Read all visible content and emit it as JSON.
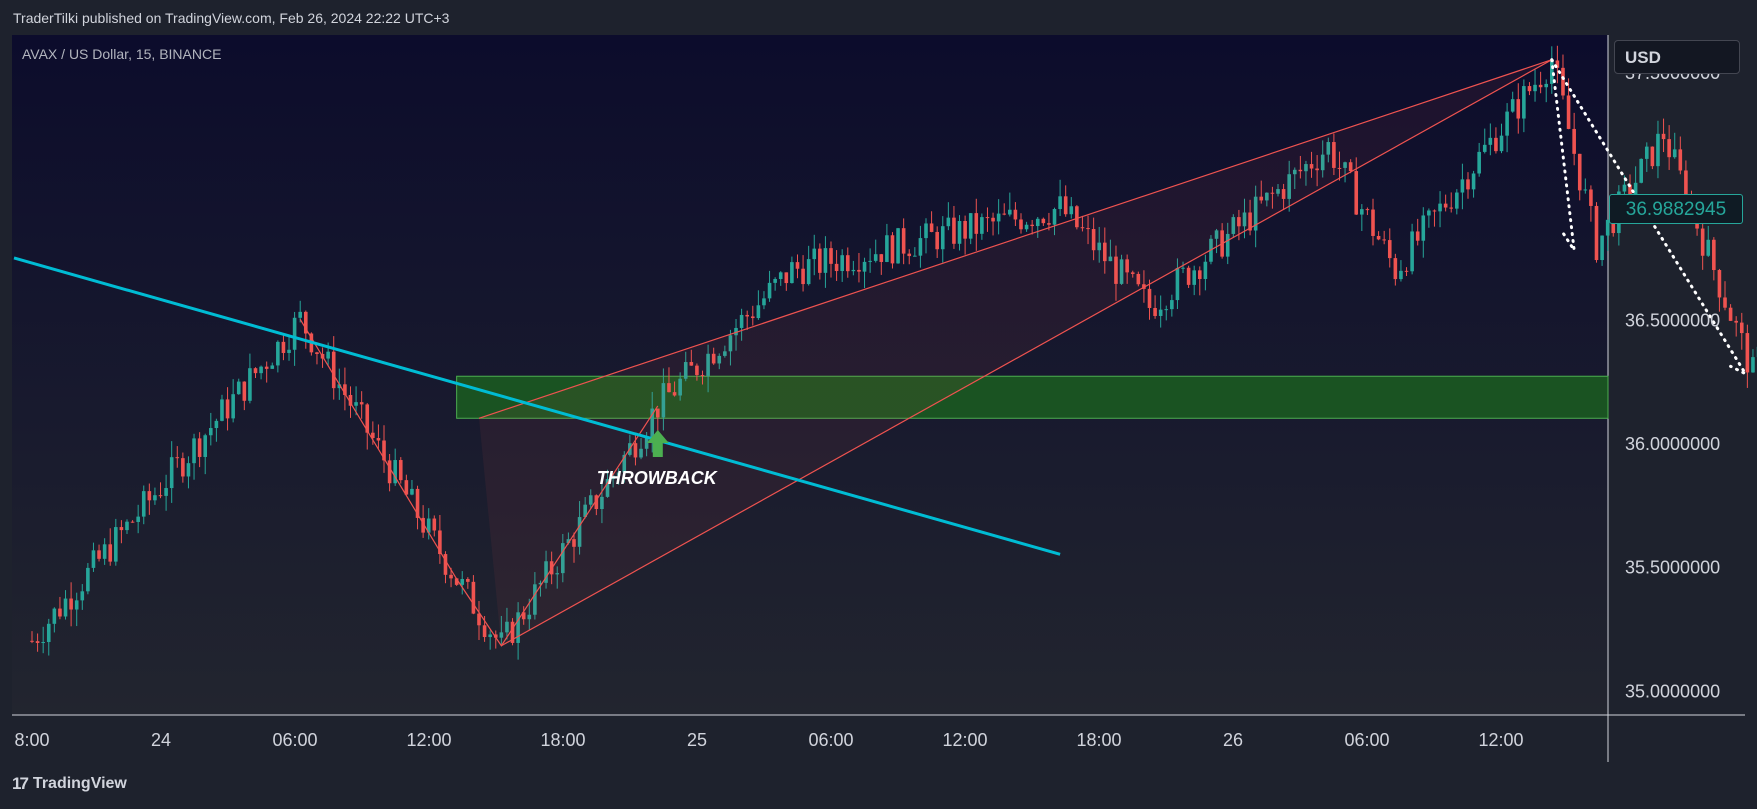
{
  "header": {
    "text": "TraderTilki published on TradingView.com, Feb 26, 2024 22:22 UTC+3"
  },
  "symbol": {
    "text": "AVAX / US Dollar, 15, BINANCE"
  },
  "currency": {
    "label": "USD"
  },
  "last_price": {
    "label": "36.9882945",
    "value": 36.9882945,
    "color": "#26a69a"
  },
  "annotation": {
    "throwback": "THROWBACK",
    "arrow_color": "#4caf50"
  },
  "footer": {
    "logo_mark": "17",
    "brand": "TradingView"
  },
  "colors": {
    "background": "#131722",
    "up": "#26a69a",
    "down": "#ef5350",
    "trendline": "#00bcd4",
    "zone": "#1b5e20",
    "zone_border": "#4caf50",
    "pattern": "#ef5350"
  },
  "chart_data": {
    "type": "candlestick",
    "title": "AVAX / US Dollar, 15, BINANCE",
    "ylim": [
      34.9,
      37.65
    ],
    "y_ticks": [
      "37.5000000",
      "36.5000000",
      "36.0000000",
      "35.5000000",
      "35.0000000"
    ],
    "y_tick_values": [
      37.5,
      36.5,
      36.0,
      35.5,
      35.0
    ],
    "x_ticks": [
      "8:00",
      "24",
      "06:00",
      "12:00",
      "18:00",
      "25",
      "06:00",
      "12:00",
      "18:00",
      "26",
      "06:00",
      "12:00"
    ],
    "support_zone": {
      "low": 36.1,
      "high": 36.27,
      "start": "Feb 24 03:00"
    },
    "descending_trendline": [
      [
        "Feb 23 08:00",
        36.72
      ],
      [
        "Feb 25 06:00",
        35.55
      ]
    ],
    "rising_wedge_upper": [
      [
        "Feb 24 04:00",
        36.1
      ],
      [
        "Feb 26 04:00",
        37.55
      ]
    ],
    "rising_wedge_lower": [
      [
        "Feb 24 05:00",
        35.18
      ],
      [
        "Feb 26 04:00",
        37.55
      ]
    ],
    "key_points": [
      {
        "time": "Feb 23 08:00",
        "price": 35.2
      },
      {
        "time": "Feb 23 20:00",
        "price": 36.5
      },
      {
        "time": "Feb 24 03:00",
        "price": 35.45
      },
      {
        "time": "Feb 24 05:00",
        "price": 35.18
      },
      {
        "time": "Feb 24 12:00",
        "price": 36.15
      },
      {
        "time": "Feb 24 18:00",
        "price": 36.7
      },
      {
        "time": "Feb 25 06:00",
        "price": 36.95
      },
      {
        "time": "Feb 25 10:00",
        "price": 36.55
      },
      {
        "time": "Feb 25 18:00",
        "price": 37.2
      },
      {
        "time": "Feb 25 21:00",
        "price": 36.7
      },
      {
        "time": "Feb 26 04:00",
        "price": 37.55
      },
      {
        "time": "Feb 26 06:00",
        "price": 36.8
      },
      {
        "time": "Feb 26 09:00",
        "price": 37.25
      },
      {
        "time": "Feb 26 13:00",
        "price": 36.28
      },
      {
        "time": "Feb 26 16:00",
        "price": 36.99
      }
    ]
  }
}
